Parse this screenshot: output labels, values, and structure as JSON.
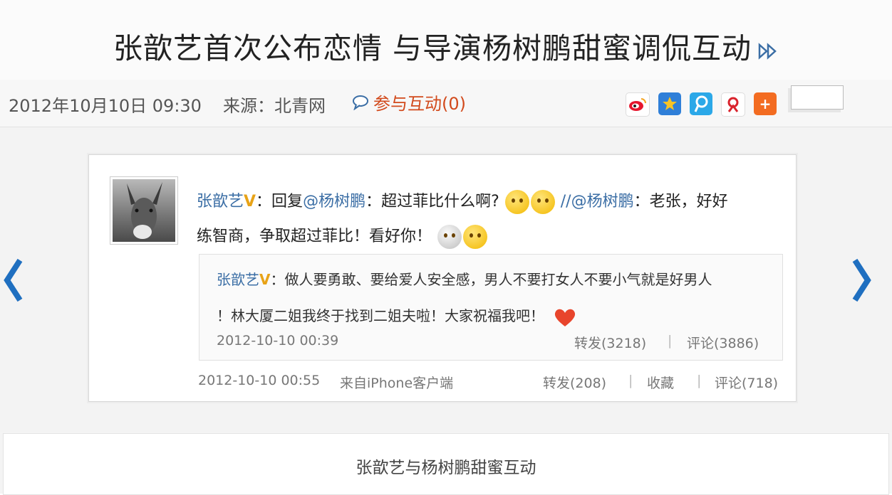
{
  "article": {
    "title": "张歆艺首次公布恋情 与导演杨树鹏甜蜜调侃互动",
    "date": "2012年10月10日 09:30",
    "source": "来源：北青网",
    "interact": "参与互动(0)"
  },
  "share_icons": [
    "weibo-icon",
    "qzone-icon",
    "tencent-weibo-icon",
    "renren-icon",
    "more-share-icon"
  ],
  "tweet": {
    "author": "张歆艺",
    "verified_mark": "V",
    "reply_prefix": "：回复",
    "mention": "@杨树鹏",
    "text1": "：超过菲比什么啊?",
    "repost_sep": "//",
    "mention2": "@杨树鹏",
    "text2": "：老张，好好",
    "line2": "练智商，争取超过菲比！看好你！",
    "time": "2012-10-10 00:55",
    "client": "来自iPhone客户端",
    "forward": "转发(208)",
    "favorite": "收藏",
    "comment": "评论(718)"
  },
  "quoted": {
    "author": "张歆艺",
    "verified_mark": "V",
    "line1": "：做人要勇敢、要给爱人安全感，男人不要打女人不要小气就是好男人",
    "line2": "！林大厦二姐我终于找到二姐夫啦！大家祝福我吧！",
    "time": "2012-10-10 00:39",
    "forward": "转发(3218)",
    "comment": "评论(3886)"
  },
  "caption": "张歆艺与杨树鹏甜蜜互动",
  "colors": {
    "link": "#3b6ea5",
    "interact": "#d24a1c",
    "nav_arrow": "#1f6fc0"
  }
}
